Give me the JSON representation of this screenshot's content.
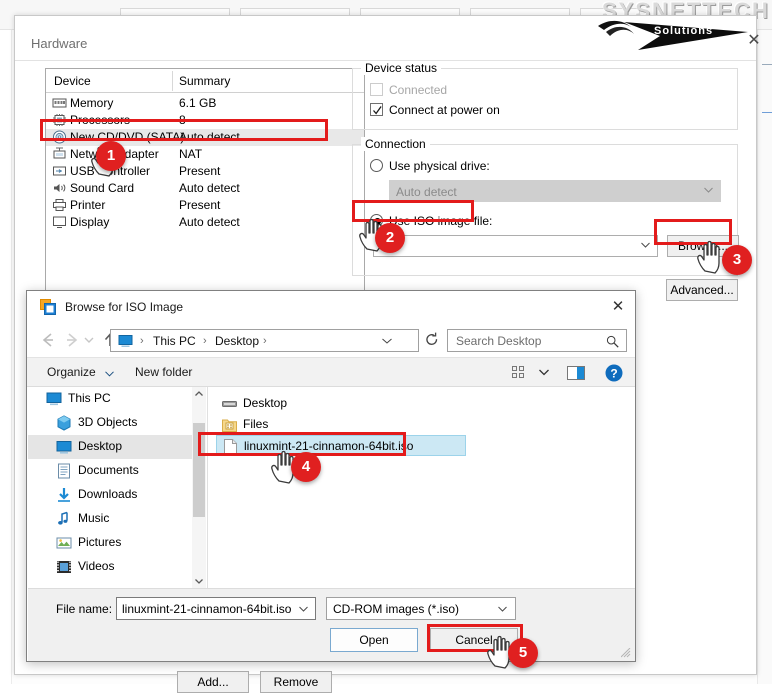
{
  "watermark": {
    "brand": "SYSNETTECH",
    "sub": "Solutions"
  },
  "hardware_window": {
    "title": "Hardware",
    "close_label": "✕",
    "device_table": {
      "columns": [
        "Device",
        "Summary"
      ],
      "rows": [
        {
          "icon": "memory-icon",
          "device": "Memory",
          "summary": "6.1 GB",
          "selected": false
        },
        {
          "icon": "processor-icon",
          "device": "Processors",
          "summary": "8",
          "selected": false
        },
        {
          "icon": "cd-dvd-icon",
          "device": "New CD/DVD (SATA)",
          "summary": "Auto detect",
          "selected": true
        },
        {
          "icon": "network-icon",
          "device": "Network Adapter",
          "summary": "NAT",
          "selected": false
        },
        {
          "icon": "usb-icon",
          "device": "USB Controller",
          "summary": "Present",
          "selected": false
        },
        {
          "icon": "sound-icon",
          "device": "Sound Card",
          "summary": "Auto detect",
          "selected": false
        },
        {
          "icon": "printer-icon",
          "device": "Printer",
          "summary": "Present",
          "selected": false
        },
        {
          "icon": "display-icon",
          "device": "Display",
          "summary": "Auto detect",
          "selected": false
        }
      ]
    },
    "device_status": {
      "legend": "Device status",
      "connected_label": "Connected",
      "connected_checked": false,
      "connected_enabled": false,
      "connect_at_power_on_label": "Connect at power on",
      "connect_at_power_on_checked": true
    },
    "connection": {
      "legend": "Connection",
      "use_physical_drive_label": "Use physical drive:",
      "use_physical_drive_selected": false,
      "physical_drive_value": "Auto detect",
      "use_iso_label": "Use ISO image file:",
      "use_iso_selected": true,
      "iso_path_value": "",
      "browse_label": "Browse...",
      "advanced_label": "Advanced..."
    },
    "footer": {
      "add_label": "Add...",
      "remove_label": "Remove"
    }
  },
  "browse_dialog": {
    "title": "Browse for ISO Image",
    "close_label": "✕",
    "nav": {
      "back_icon": "back-arrow-icon",
      "forward_icon": "forward-arrow-icon",
      "recent_icon": "recent-locations-icon",
      "up_icon": "up-arrow-icon",
      "refresh_icon": "refresh-icon"
    },
    "breadcrumb": {
      "root_icon": "this-pc-icon",
      "parts": [
        "This PC",
        "Desktop"
      ],
      "separator": "›"
    },
    "search": {
      "placeholder": "Search Desktop",
      "icon": "search-icon"
    },
    "command_bar": {
      "organize_label": "Organize",
      "new_folder_label": "New folder",
      "view_icon": "view-options-icon",
      "preview_icon": "preview-pane-icon",
      "help_icon": "help-icon",
      "help_glyph": "?"
    },
    "nav_tree": [
      {
        "label": "This PC",
        "icon": "this-pc-icon",
        "indent": 18,
        "selected": false
      },
      {
        "label": "3D Objects",
        "icon": "3d-objects-icon",
        "indent": 28,
        "selected": false
      },
      {
        "label": "Desktop",
        "icon": "desktop-icon",
        "indent": 28,
        "selected": true
      },
      {
        "label": "Documents",
        "icon": "documents-icon",
        "indent": 28,
        "selected": false
      },
      {
        "label": "Downloads",
        "icon": "downloads-icon",
        "indent": 28,
        "selected": false
      },
      {
        "label": "Music",
        "icon": "music-icon",
        "indent": 28,
        "selected": false
      },
      {
        "label": "Pictures",
        "icon": "pictures-icon",
        "indent": 28,
        "selected": false
      },
      {
        "label": "Videos",
        "icon": "videos-icon",
        "indent": 28,
        "selected": false
      }
    ],
    "file_list": [
      {
        "name": "Desktop",
        "icon": "desktop-folder-icon",
        "selected": false
      },
      {
        "name": "Files",
        "icon": "folder-icon",
        "selected": false
      },
      {
        "name": "linuxmint-21-cinnamon-64bit.iso",
        "icon": "file-icon",
        "selected": true
      }
    ],
    "footer": {
      "file_name_label": "File name:",
      "file_name_value": "linuxmint-21-cinnamon-64bit.iso",
      "file_type_value": "CD-ROM images (*.iso)",
      "open_label": "Open",
      "cancel_label": "Cancel"
    }
  },
  "annotations": {
    "accent_color": "#e02020",
    "badges": [
      {
        "n": "1"
      },
      {
        "n": "2"
      },
      {
        "n": "3"
      },
      {
        "n": "4"
      },
      {
        "n": "5"
      }
    ]
  }
}
